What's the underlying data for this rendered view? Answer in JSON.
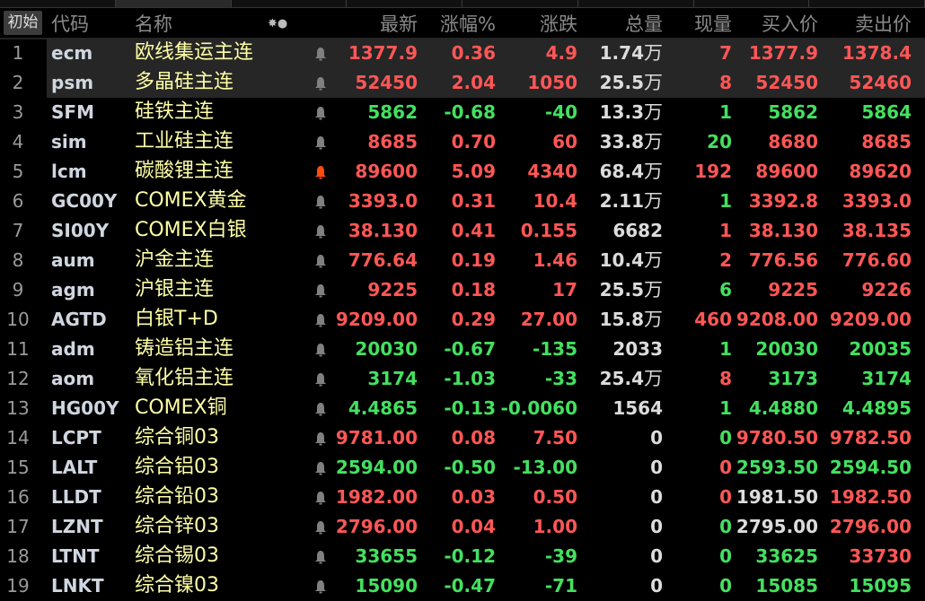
{
  "header": {
    "init_button": "初始",
    "columns": {
      "code": "代码",
      "name": "名称",
      "settings": "✸●",
      "last": "最新",
      "pct": "涨幅%",
      "chg": "涨跌",
      "vol": "总量",
      "cur": "现量",
      "bid": "买入价",
      "ask": "卖出价"
    }
  },
  "colors": {
    "up": "#ff5656",
    "down": "#44e060",
    "flat": "#dcdcdc",
    "name": "#ffffa8",
    "alert_active": "#ff4a10",
    "alert_idle": "#808080"
  },
  "rows": [
    {
      "n": "1",
      "code": "ecm",
      "name": "欧线集运主连",
      "last": "1377.9",
      "pct": "0.36",
      "chg": "4.9",
      "vol": "1.74",
      "vol_unit": "万",
      "cur": "7",
      "bid": "1377.9",
      "ask": "1378.4",
      "c": "r",
      "cc": "r",
      "bc": "r",
      "ac": "r",
      "alert": false,
      "selected": true
    },
    {
      "n": "2",
      "code": "psm",
      "name": "多晶硅主连",
      "last": "52450",
      "pct": "2.04",
      "chg": "1050",
      "vol": "25.5",
      "vol_unit": "万",
      "cur": "8",
      "bid": "52450",
      "ask": "52460",
      "c": "r",
      "cc": "r",
      "bc": "r",
      "ac": "r",
      "alert": false,
      "selected": true
    },
    {
      "n": "3",
      "code": "SFM",
      "name": "硅铁主连",
      "last": "5862",
      "pct": "-0.68",
      "chg": "-40",
      "vol": "13.3",
      "vol_unit": "万",
      "cur": "1",
      "bid": "5862",
      "ask": "5864",
      "c": "g",
      "cc": "g",
      "bc": "g",
      "ac": "g",
      "alert": false
    },
    {
      "n": "4",
      "code": "sim",
      "name": "工业硅主连",
      "last": "8685",
      "pct": "0.70",
      "chg": "60",
      "vol": "33.8",
      "vol_unit": "万",
      "cur": "20",
      "bid": "8680",
      "ask": "8685",
      "c": "r",
      "cc": "g",
      "bc": "r",
      "ac": "r",
      "alert": false
    },
    {
      "n": "5",
      "code": "lcm",
      "name": "碳酸锂主连",
      "last": "89600",
      "pct": "5.09",
      "chg": "4340",
      "vol": "68.4",
      "vol_unit": "万",
      "cur": "192",
      "bid": "89600",
      "ask": "89620",
      "c": "r",
      "cc": "r",
      "bc": "r",
      "ac": "r",
      "alert": true
    },
    {
      "n": "6",
      "code": "GC00Y",
      "name": "COMEX黄金",
      "last": "3393.0",
      "pct": "0.31",
      "chg": "10.4",
      "vol": "2.11",
      "vol_unit": "万",
      "cur": "1",
      "bid": "3392.8",
      "ask": "3393.0",
      "c": "r",
      "cc": "g",
      "bc": "r",
      "ac": "r",
      "alert": false
    },
    {
      "n": "7",
      "code": "SI00Y",
      "name": "COMEX白银",
      "last": "38.130",
      "pct": "0.41",
      "chg": "0.155",
      "vol": "6682",
      "vol_unit": "",
      "cur": "1",
      "bid": "38.130",
      "ask": "38.135",
      "c": "r",
      "cc": "r",
      "bc": "r",
      "ac": "r",
      "alert": false
    },
    {
      "n": "8",
      "code": "aum",
      "name": "沪金主连",
      "last": "776.64",
      "pct": "0.19",
      "chg": "1.46",
      "vol": "10.4",
      "vol_unit": "万",
      "cur": "2",
      "bid": "776.56",
      "ask": "776.60",
      "c": "r",
      "cc": "r",
      "bc": "r",
      "ac": "r",
      "alert": false
    },
    {
      "n": "9",
      "code": "agm",
      "name": "沪银主连",
      "last": "9225",
      "pct": "0.18",
      "chg": "17",
      "vol": "25.5",
      "vol_unit": "万",
      "cur": "6",
      "bid": "9225",
      "ask": "9226",
      "c": "r",
      "cc": "g",
      "bc": "r",
      "ac": "r",
      "alert": false
    },
    {
      "n": "10",
      "code": "AGTD",
      "name": "白银T+D",
      "last": "9209.00",
      "pct": "0.29",
      "chg": "27.00",
      "vol": "15.8",
      "vol_unit": "万",
      "cur": "460",
      "bid": "9208.00",
      "ask": "9209.00",
      "c": "r",
      "cc": "r",
      "bc": "r",
      "ac": "r",
      "alert": false
    },
    {
      "n": "11",
      "code": "adm",
      "name": "铸造铝主连",
      "last": "20030",
      "pct": "-0.67",
      "chg": "-135",
      "vol": "2033",
      "vol_unit": "",
      "cur": "1",
      "bid": "20030",
      "ask": "20035",
      "c": "g",
      "cc": "g",
      "bc": "g",
      "ac": "g",
      "alert": false
    },
    {
      "n": "12",
      "code": "aom",
      "name": "氧化铝主连",
      "last": "3174",
      "pct": "-1.03",
      "chg": "-33",
      "vol": "25.4",
      "vol_unit": "万",
      "cur": "8",
      "bid": "3173",
      "ask": "3174",
      "c": "g",
      "cc": "r",
      "bc": "g",
      "ac": "g",
      "alert": false
    },
    {
      "n": "13",
      "code": "HG00Y",
      "name": "COMEX铜",
      "last": "4.4865",
      "pct": "-0.13",
      "chg": "-0.0060",
      "vol": "1564",
      "vol_unit": "",
      "cur": "1",
      "bid": "4.4880",
      "ask": "4.4895",
      "c": "g",
      "cc": "g",
      "bc": "g",
      "ac": "g",
      "alert": false
    },
    {
      "n": "14",
      "code": "LCPT",
      "name": "综合铜03",
      "last": "9781.00",
      "pct": "0.08",
      "chg": "7.50",
      "vol": "0",
      "vol_unit": "",
      "cur": "0",
      "bid": "9780.50",
      "ask": "9782.50",
      "c": "r",
      "cc": "g",
      "bc": "r",
      "ac": "r",
      "alert": false
    },
    {
      "n": "15",
      "code": "LALT",
      "name": "综合铝03",
      "last": "2594.00",
      "pct": "-0.50",
      "chg": "-13.00",
      "vol": "0",
      "vol_unit": "",
      "cur": "0",
      "bid": "2593.50",
      "ask": "2594.50",
      "c": "g",
      "cc": "r",
      "bc": "g",
      "ac": "g",
      "alert": false
    },
    {
      "n": "16",
      "code": "LLDT",
      "name": "综合铅03",
      "last": "1982.00",
      "pct": "0.03",
      "chg": "0.50",
      "vol": "0",
      "vol_unit": "",
      "cur": "0",
      "bid": "1981.50",
      "ask": "1982.50",
      "c": "r",
      "cc": "r",
      "bc": "w",
      "ac": "r",
      "alert": false
    },
    {
      "n": "17",
      "code": "LZNT",
      "name": "综合锌03",
      "last": "2796.00",
      "pct": "0.04",
      "chg": "1.00",
      "vol": "0",
      "vol_unit": "",
      "cur": "0",
      "bid": "2795.00",
      "ask": "2796.00",
      "c": "r",
      "cc": "g",
      "bc": "w",
      "ac": "r",
      "alert": false
    },
    {
      "n": "18",
      "code": "LTNT",
      "name": "综合锡03",
      "last": "33655",
      "pct": "-0.12",
      "chg": "-39",
      "vol": "0",
      "vol_unit": "",
      "cur": "0",
      "bid": "33625",
      "ask": "33730",
      "c": "g",
      "cc": "g",
      "bc": "g",
      "ac": "r",
      "alert": false
    },
    {
      "n": "19",
      "code": "LNKT",
      "name": "综合镍03",
      "last": "15090",
      "pct": "-0.47",
      "chg": "-71",
      "vol": "0",
      "vol_unit": "",
      "cur": "0",
      "bid": "15085",
      "ask": "15095",
      "c": "g",
      "cc": "g",
      "bc": "g",
      "ac": "g",
      "alert": false
    }
  ]
}
